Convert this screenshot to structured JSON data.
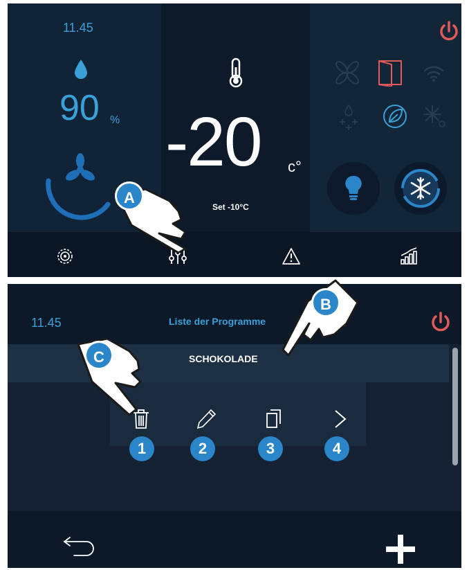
{
  "screen1": {
    "time": "11.45",
    "humidity": {
      "value": "90",
      "unit": "%"
    },
    "temperature": {
      "value": "-20",
      "unit": "c°"
    },
    "setpoint": "Set -10°C",
    "status_icons": [
      "fan-icon",
      "door-icon",
      "wifi-icon",
      "defrost-icon",
      "eco-leaf-icon",
      "snowflake-icon"
    ],
    "buttons": [
      "light-bulb-icon",
      "cycle-snowflake-icon"
    ],
    "nav": [
      "settings-icon",
      "sliders-icon",
      "warning-icon",
      "chart-icon"
    ]
  },
  "screen2": {
    "time": "11.45",
    "title": "Liste der Programme",
    "program_name": "SCHOKOLADE",
    "actions": [
      "trash-icon",
      "pencil-icon",
      "copy-icon",
      "chevron-right-icon"
    ],
    "badges": [
      "1",
      "2",
      "3",
      "4"
    ]
  },
  "callouts": [
    "A",
    "B",
    "C"
  ],
  "colors": {
    "accent": "#3aa0d8",
    "power": "#e05a5a",
    "badge": "#2a86c8",
    "panel": "#0f1d2d"
  }
}
